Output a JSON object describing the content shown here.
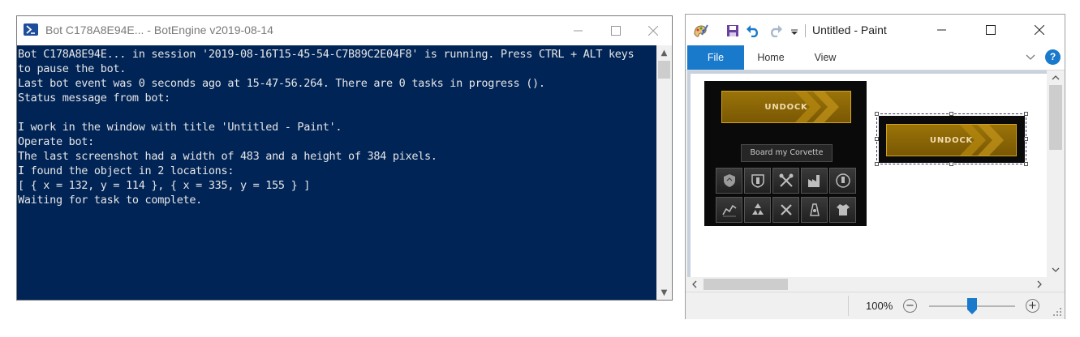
{
  "console": {
    "title": "Bot C178A8E94E... - BotEngine v2019-08-14",
    "lines": [
      "Bot C178A8E94E... in session '2019-08-16T15-45-54-C7B89C2E04F8' is running. Press CTRL + ALT keys",
      "to pause the bot.",
      "Last bot event was 0 seconds ago at 15-47-56.264. There are 0 tasks in progress ().",
      "Status message from bot:",
      "",
      "I work in the window with title 'Untitled - Paint'.",
      "Operate bot:",
      "The last screenshot had a width of 483 and a height of 384 pixels.",
      "I found the object in 2 locations:",
      "[ { x = 132, y = 114 }, { x = 335, y = 155 } ]",
      "Waiting for task to complete."
    ]
  },
  "paint": {
    "title": "Untitled - Paint",
    "tabs": {
      "file": "File",
      "home": "Home",
      "view": "View"
    },
    "help": "?",
    "zoom": "100%",
    "zoom_level": 0.5
  },
  "game": {
    "undock_label": "UNDOCK",
    "board_label": "Board my Corvette",
    "icons": [
      "insurance-icon",
      "fitting-icon",
      "repairshop-icon",
      "factory-icon",
      "agents-icon",
      "market-icon",
      "reprocessing-icon",
      "repair-icon",
      "cloning-icon",
      "wardrobe-icon"
    ]
  },
  "colors": {
    "console_bg": "#012456",
    "accent_blue": "#1979ca",
    "undock_gold": "#8a6606"
  }
}
